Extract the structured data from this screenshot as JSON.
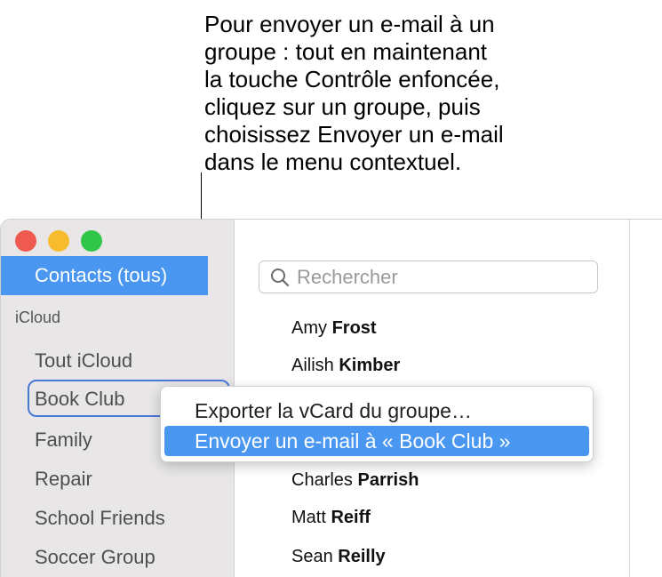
{
  "callout": {
    "text": "Pour envoyer un e-mail à un\ngroupe : tout en maintenant\nla touche Contrôle enfoncée,\ncliquez sur un groupe, puis\nchoisissez Envoyer un e-mail\ndans le menu contextuel."
  },
  "window": {
    "traffic_lights": {
      "close": "#ee5a50",
      "minimize": "#f7bc2e",
      "zoom": "#30c748"
    }
  },
  "sidebar": {
    "selected_label": "Contacts (tous)",
    "section_header": "iCloud",
    "items": [
      {
        "label": "Tout iCloud"
      },
      {
        "label": "Book Club"
      },
      {
        "label": "Family"
      },
      {
        "label": "Repair"
      },
      {
        "label": "School Friends"
      },
      {
        "label": "Soccer Group"
      }
    ]
  },
  "search": {
    "placeholder": "Rechercher",
    "icon": "search-icon"
  },
  "contacts": [
    {
      "first": "Amy",
      "last": "Frost"
    },
    {
      "first": "Ailish",
      "last": "Kimber"
    },
    {
      "first": "Charles",
      "last": "Parrish"
    },
    {
      "first": "Matt",
      "last": "Reiff"
    },
    {
      "first": "Sean",
      "last": "Reilly"
    }
  ],
  "context_menu": {
    "items": [
      {
        "label": "Exporter la vCard du groupe…"
      },
      {
        "label": "Envoyer un e-mail à « Book Club »"
      }
    ]
  },
  "colors": {
    "accent": "#4a97f1",
    "focus_ring": "#4a78d6",
    "sidebar_bg": "#e8e6e7"
  }
}
